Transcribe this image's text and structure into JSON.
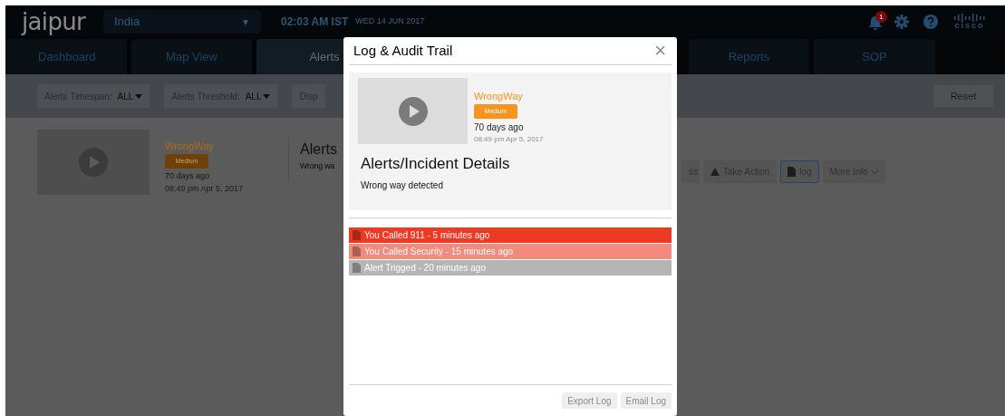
{
  "header": {
    "logo": "jaipur",
    "country_select": {
      "value": "India",
      "arrow": "▼"
    },
    "time": "02:03 AM IST",
    "date": "WED 14 JUN 2017",
    "notifications": {
      "badge": "1"
    },
    "brand": "cisco"
  },
  "tabs": [
    {
      "label": "Dashboard",
      "selected": false
    },
    {
      "label": "Map View",
      "selected": false
    },
    {
      "label": "Alerts",
      "selected": true
    },
    {
      "label": "Reports",
      "selected": false
    },
    {
      "label": "SOP",
      "selected": false
    }
  ],
  "filters": [
    {
      "label": "Alerts Timespan:",
      "value": "ALL"
    },
    {
      "label": "Alerts Threshold:",
      "value": "ALL"
    },
    {
      "label": "Disp"
    }
  ],
  "reset_button": "Reset",
  "alert_card": {
    "name": "WrongWay",
    "severity": "Medium",
    "age": "70 days ago",
    "timestamp": "08:49 pm Apr 5, 2017",
    "title": "Alerts",
    "description": "Wrong wa",
    "actions": [
      {
        "kind": "plain",
        "label": "ss"
      },
      {
        "kind": "warning",
        "label": "Take Action"
      },
      {
        "kind": "log",
        "label": "log",
        "selected": true
      },
      {
        "kind": "menu",
        "label": "More Info"
      }
    ]
  },
  "modal": {
    "title": "Log & Audit Trail",
    "close": "×",
    "alert": {
      "name": "WrongWay",
      "severity": "Medium",
      "age": "70 days ago",
      "timestamp": "08:49 pm Apr 5, 2017"
    },
    "details_heading": "Alerts/Incident Details",
    "details_text": "Wrong way detected",
    "log_entries": [
      {
        "text": "You Called 911 - 5 minutes ago",
        "color": "#ee3a23"
      },
      {
        "text": "You Called Security - 15 minutes ago",
        "color": "#f28b7c"
      },
      {
        "text": "Alert Trigged - 20 minutes ago",
        "color": "#b5b5b5"
      }
    ],
    "buttons": [
      "Export Log",
      "Email Log"
    ]
  }
}
